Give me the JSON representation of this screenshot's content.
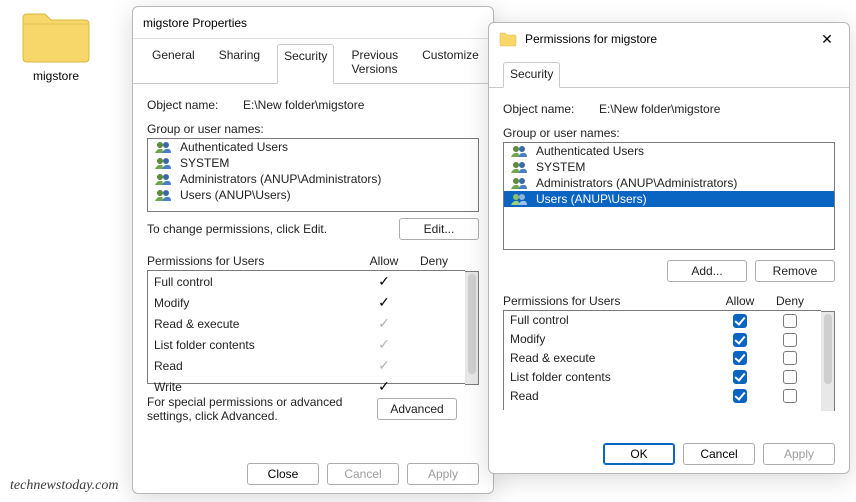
{
  "desktop": {
    "folder_label": "migstore"
  },
  "watermark": "technewstoday.com",
  "win1": {
    "title": "migstore Properties",
    "tabs": {
      "general": "General",
      "sharing": "Sharing",
      "security": "Security",
      "prev": "Previous Versions",
      "custom": "Customize"
    },
    "object_label": "Object name:",
    "object_value": "E:\\New folder\\migstore",
    "group_label": "Group or user names:",
    "groups": {
      "g0": "Authenticated Users",
      "g1": "SYSTEM",
      "g2": "Administrators (ANUP\\Administrators)",
      "g3": "Users (ANUP\\Users)"
    },
    "change_hint": "To change permissions, click Edit.",
    "btn_edit": "Edit...",
    "perm_header_title": "Permissions for Users",
    "col_allow": "Allow",
    "col_deny": "Deny",
    "perms": {
      "p0": "Full control",
      "p1": "Modify",
      "p2": "Read & execute",
      "p3": "List folder contents",
      "p4": "Read",
      "p5": "Write"
    },
    "special_hint": "For special permissions or advanced settings, click Advanced.",
    "btn_advanced": "Advanced",
    "btn_close": "Close",
    "btn_cancel": "Cancel",
    "btn_apply": "Apply"
  },
  "win2": {
    "title": "Permissions for migstore",
    "tab_security": "Security",
    "object_label": "Object name:",
    "object_value": "E:\\New folder\\migstore",
    "group_label": "Group or user names:",
    "groups": {
      "g0": "Authenticated Users",
      "g1": "SYSTEM",
      "g2": "Administrators (ANUP\\Administrators)",
      "g3": "Users (ANUP\\Users)"
    },
    "btn_add": "Add...",
    "btn_remove": "Remove",
    "perm_header_title": "Permissions for Users",
    "col_allow": "Allow",
    "col_deny": "Deny",
    "perms": {
      "p0": "Full control",
      "p1": "Modify",
      "p2": "Read & execute",
      "p3": "List folder contents",
      "p4": "Read"
    },
    "btn_ok": "OK",
    "btn_cancel": "Cancel",
    "btn_apply": "Apply"
  }
}
